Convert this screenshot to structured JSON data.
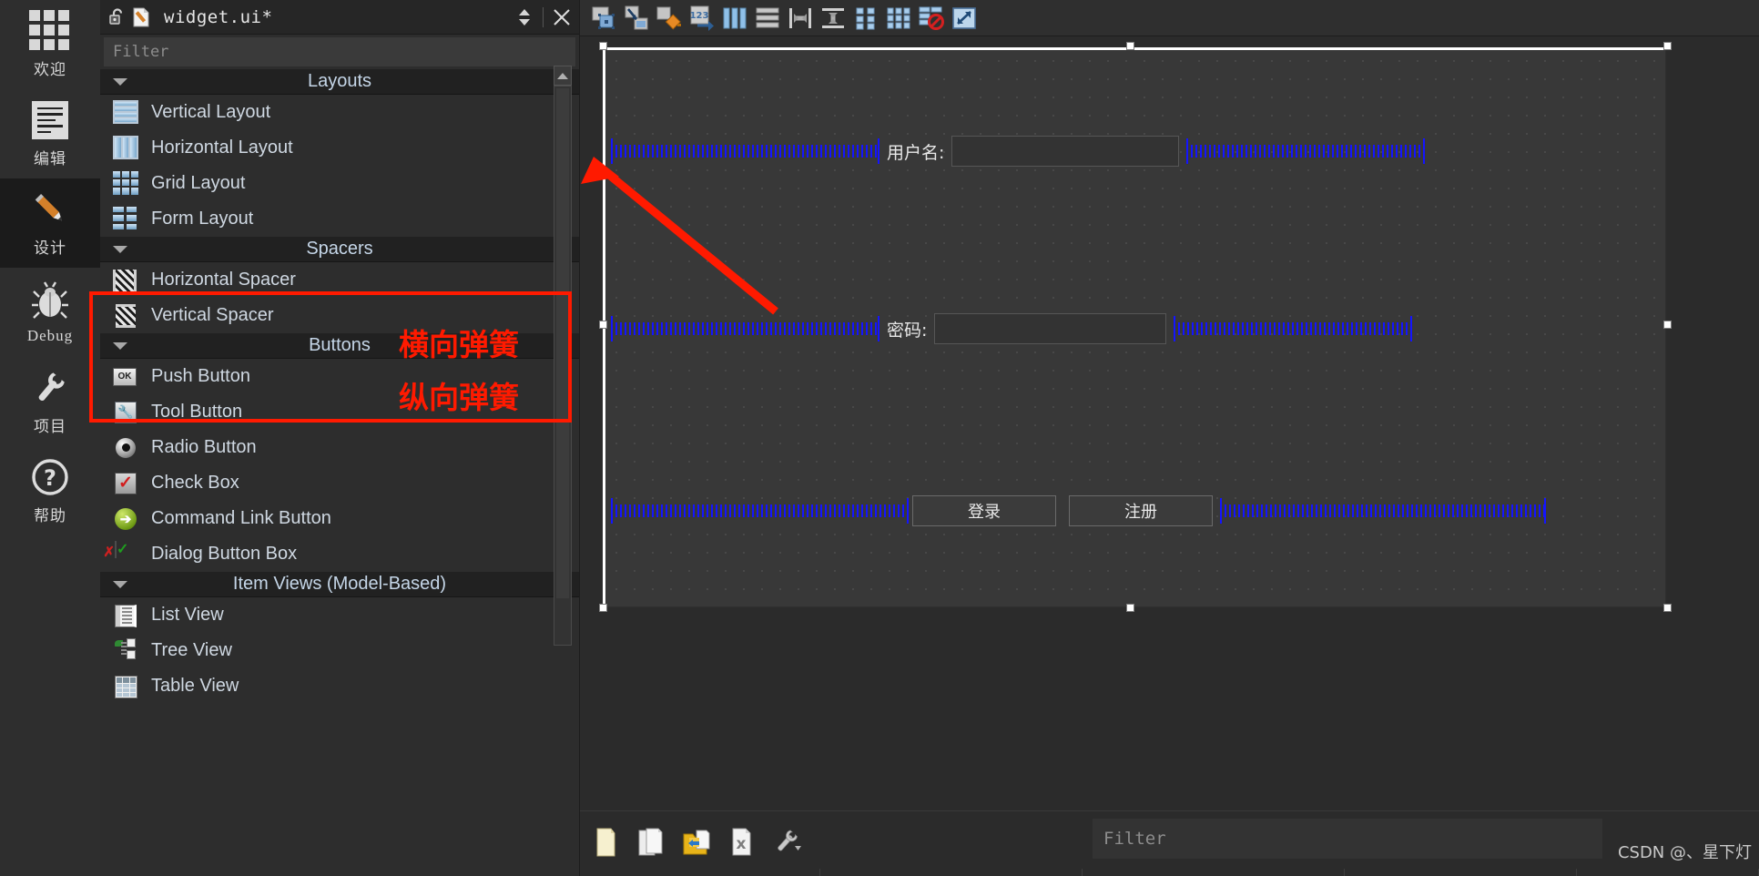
{
  "mode_sidebar": {
    "items": [
      {
        "label": "欢迎",
        "icon": "grid-icon",
        "active": false
      },
      {
        "label": "编辑",
        "icon": "document-lines-icon",
        "active": false
      },
      {
        "label": "设计",
        "icon": "pencil-icon",
        "active": true
      },
      {
        "label": "Debug",
        "icon": "bug-icon",
        "active": false
      },
      {
        "label": "项目",
        "icon": "wrench-icon",
        "active": false
      },
      {
        "label": "帮助",
        "icon": "question-mark-icon",
        "active": false
      }
    ]
  },
  "widget_box": {
    "title": "widget.ui*",
    "lock_icon": "unlocked-padlock-icon",
    "file_icon": "ui-file-pencil-icon",
    "split_icon": "updown-chevrons-icon",
    "close_icon": "close-x-icon",
    "filter_placeholder": "Filter",
    "groups": [
      {
        "label": "Layouts",
        "items": [
          {
            "label": "Vertical Layout",
            "icon": "vertical-layout-icon"
          },
          {
            "label": "Horizontal Layout",
            "icon": "horizontal-layout-icon"
          },
          {
            "label": "Grid Layout",
            "icon": "grid-layout-icon"
          },
          {
            "label": "Form Layout",
            "icon": "form-layout-icon"
          }
        ]
      },
      {
        "label": "Spacers",
        "items": [
          {
            "label": "Horizontal Spacer",
            "icon": "horizontal-spacer-icon"
          },
          {
            "label": "Vertical Spacer",
            "icon": "vertical-spacer-icon"
          }
        ]
      },
      {
        "label": "Buttons",
        "items": [
          {
            "label": "Push Button",
            "icon": "push-button-icon"
          },
          {
            "label": "Tool Button",
            "icon": "tool-button-icon"
          },
          {
            "label": "Radio Button",
            "icon": "radio-button-icon"
          },
          {
            "label": "Check Box",
            "icon": "check-box-icon"
          },
          {
            "label": "Command Link Button",
            "icon": "command-link-button-icon"
          },
          {
            "label": "Dialog Button Box",
            "icon": "dialog-button-box-icon"
          }
        ]
      },
      {
        "label": "Item Views (Model-Based)",
        "items": [
          {
            "label": "List View",
            "icon": "list-view-icon"
          },
          {
            "label": "Tree View",
            "icon": "tree-view-icon"
          },
          {
            "label": "Table View",
            "icon": "table-view-icon"
          }
        ]
      }
    ]
  },
  "designer_toolbar": {
    "buttons": [
      {
        "name": "edit-widgets-icon",
        "tooltip": "Edit Widgets"
      },
      {
        "name": "edit-signals-slots-icon",
        "tooltip": "Edit Signals/Slots"
      },
      {
        "name": "edit-buddies-icon",
        "tooltip": "Edit Buddies"
      },
      {
        "name": "edit-tab-order-icon",
        "tooltip": "Edit Tab Order"
      },
      {
        "name": "layout-horizontally-icon",
        "tooltip": "Lay Out Horizontally"
      },
      {
        "name": "layout-vertically-icon",
        "tooltip": "Lay Out Vertically"
      },
      {
        "name": "layout-splitter-h-icon",
        "tooltip": "Lay Out Horizontally in Splitter"
      },
      {
        "name": "layout-splitter-v-icon",
        "tooltip": "Lay Out Vertically in Splitter"
      },
      {
        "name": "layout-form-icon",
        "tooltip": "Lay Out in a Form Layout"
      },
      {
        "name": "layout-grid-icon",
        "tooltip": "Lay Out in a Grid"
      },
      {
        "name": "break-layout-icon",
        "tooltip": "Break Layout"
      },
      {
        "name": "adjust-size-icon",
        "tooltip": "Adjust Size"
      }
    ]
  },
  "form": {
    "rows": [
      {
        "id": "username-row",
        "label": "用户名:",
        "field_value": "",
        "left_spacer": "horizontalSpacer",
        "right_spacer": "horizontalSpacer_2"
      },
      {
        "id": "password-row",
        "label": "密码:",
        "field_value": "",
        "left_spacer": "horizontalSpacer_3",
        "right_spacer": "horizontalSpacer_4"
      }
    ],
    "buttons": [
      {
        "label": "登录"
      },
      {
        "label": "注册"
      }
    ],
    "button_row_spacers": [
      "horizontalSpacer_5",
      "horizontalSpacer_6"
    ]
  },
  "bottom_bar": {
    "icons": [
      {
        "name": "new-file-icon"
      },
      {
        "name": "copy-resource-icon"
      },
      {
        "name": "open-folder-import-icon"
      },
      {
        "name": "remove-file-icon"
      },
      {
        "name": "wrench-dropdown-icon"
      }
    ],
    "filter_placeholder": "Filter"
  },
  "watermark": "CSDN @、星下灯",
  "annotations": {
    "box_color": "#ff1a00",
    "text_1": "横向弹簧",
    "text_2": "纵向弹簧",
    "arrow_color": "#ff1a00"
  }
}
